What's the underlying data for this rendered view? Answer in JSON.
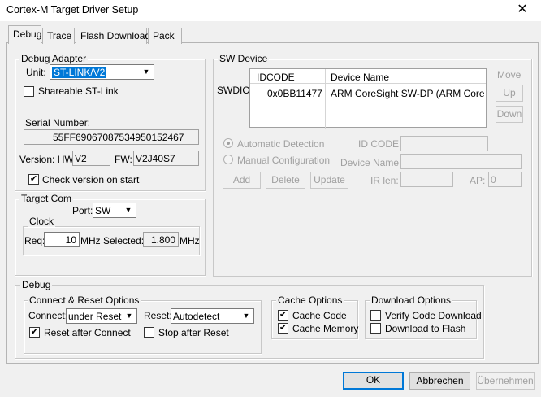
{
  "window": {
    "title": "Cortex-M Target Driver Setup",
    "close_glyph": "✕"
  },
  "tabs": [
    {
      "label": "Debug",
      "active": true
    },
    {
      "label": "Trace",
      "active": false
    },
    {
      "label": "Flash Download",
      "active": false
    },
    {
      "label": "Pack",
      "active": false
    }
  ],
  "debug_adapter": {
    "title": "Debug Adapter",
    "unit_label": "Unit:",
    "unit_value": "ST-LINK/V2",
    "shareable_label": "Shareable ST-Link",
    "shareable_checked": false,
    "serial_label": "Serial Number:",
    "serial_value": "55FF69067087534950152467",
    "version_label": "Version: HW:",
    "hw_value": "V2",
    "fw_label": "FW:",
    "fw_value": "V2J40S7",
    "check_version_label": "Check version on start",
    "check_version_checked": true
  },
  "target_com": {
    "title": "Target Com",
    "port_label": "Port:",
    "port_value": "SW",
    "clock_title": "Clock",
    "req_label": "Req:",
    "req_value": "10",
    "req_unit": "MHz",
    "selected_label": "Selected:",
    "selected_value": "1.800",
    "selected_unit": "MHz"
  },
  "sw_device": {
    "title": "SW Device",
    "side_label": "SWDIO",
    "columns": [
      "IDCODE",
      "Device Name"
    ],
    "rows": [
      {
        "idcode": "0x0BB11477",
        "device_name": "ARM CoreSight SW-DP (ARM Core"
      }
    ],
    "move_label": "Move",
    "up_label": "Up",
    "down_label": "Down",
    "auto_detect_label": "Automatic Detection",
    "manual_config_label": "Manual Configuration",
    "id_code_label": "ID CODE:",
    "device_name_label": "Device Name:",
    "ir_len_label": "IR len:",
    "ap_label": "AP:",
    "ap_value": "0",
    "add_label": "Add",
    "delete_label": "Delete",
    "update_label": "Update"
  },
  "debug": {
    "title": "Debug",
    "connect_reset": {
      "title": "Connect & Reset Options",
      "connect_label": "Connect:",
      "connect_value": "under Reset",
      "reset_label": "Reset:",
      "reset_value": "Autodetect",
      "reset_after_connect_label": "Reset after Connect",
      "reset_after_connect_checked": true,
      "stop_after_reset_label": "Stop after Reset",
      "stop_after_reset_checked": false
    },
    "cache": {
      "title": "Cache Options",
      "cache_code_label": "Cache Code",
      "cache_code_checked": true,
      "cache_memory_label": "Cache Memory",
      "cache_memory_checked": true
    },
    "download": {
      "title": "Download Options",
      "verify_label": "Verify Code Download",
      "verify_checked": false,
      "download_flash_label": "Download to Flash",
      "download_flash_checked": false
    }
  },
  "footer": {
    "ok_label": "OK",
    "cancel_label": "Abbrechen",
    "apply_label": "Übernehmen"
  },
  "glyphs": {
    "check": "✔",
    "arrow": "▼"
  }
}
